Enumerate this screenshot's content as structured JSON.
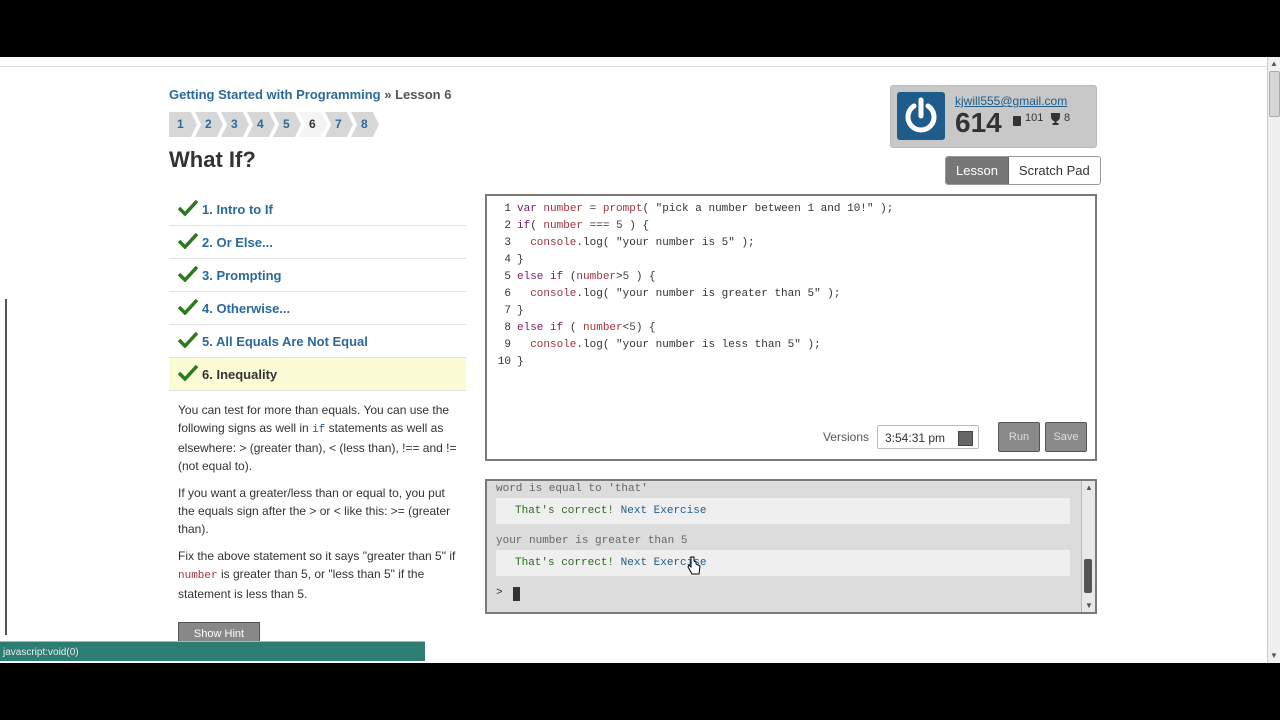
{
  "breadcrumb": {
    "course": "Getting Started with Programming",
    "separator": "»",
    "lesson": "Lesson 6"
  },
  "steps": [
    "1",
    "2",
    "3",
    "4",
    "5",
    "6",
    "7",
    "8"
  ],
  "active_step": "6",
  "page_title": "What If?",
  "profile": {
    "email": "kjwill555@gmail.com",
    "score": "614",
    "badges": "101",
    "trophies": "8"
  },
  "tabs": [
    {
      "label": "Lesson",
      "active": true
    },
    {
      "label": "Scratch Pad",
      "active": false
    }
  ],
  "lessons": [
    {
      "label": "1. Intro to If"
    },
    {
      "label": "2. Or Else..."
    },
    {
      "label": "3. Prompting"
    },
    {
      "label": "4. Otherwise..."
    },
    {
      "label": "5. All Equals Are Not Equal"
    },
    {
      "label": "6. Inequality"
    }
  ],
  "description": {
    "p1_a": "You can test for more than equals. You can use the following signs as well in ",
    "p1_code": "if",
    "p1_b": " statements as well as elsewhere: > (greater than), < (less than), !== and != (not equal to).",
    "p2": "If you want a greater/less than or equal to, you put the equals sign after the > or < like this: >= (greater than).",
    "p3_a": "Fix the above statement so it says \"greater than 5\" if ",
    "p3_code": "number",
    "p3_b": " is greater than 5, or \"less than 5\" if the statement is less than 5."
  },
  "show_button": "Show Hint",
  "status_text": "javascript:void(0)",
  "code_lines": [
    "var number = prompt( \"pick a number between 1 and 10!\" );",
    "if( number === 5 ) {",
    "  console.log( \"your number is 5\" );",
    "}",
    "else if (number>5 ) {",
    "  console.log( \"your number is greater than 5\" );",
    "}",
    "else if ( number<5) {",
    "  console.log( \"your number is less than 5\" );",
    "}"
  ],
  "editor_toolbar": {
    "versions_label": "Versions",
    "version_value": "3:54:31 pm",
    "run": "Run",
    "save": "Save"
  },
  "console": {
    "line1": "word is equal to 'that'",
    "result_text": "That's correct!",
    "next_link": "Next Exercise",
    "line2": "your number is greater than 5",
    "prompt": ">"
  }
}
